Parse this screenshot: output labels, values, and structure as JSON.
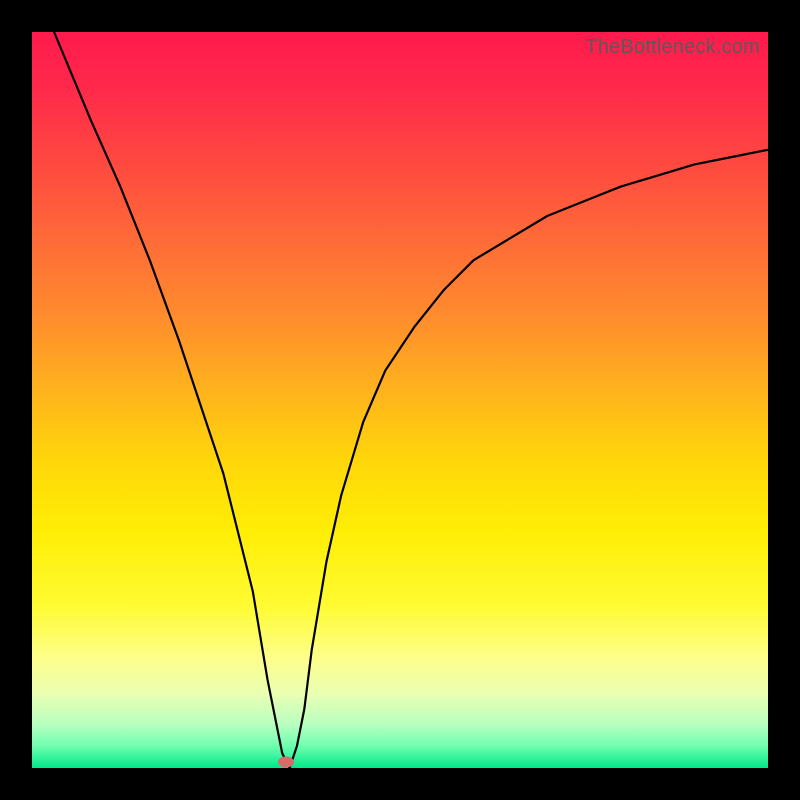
{
  "watermark": "TheBottleneck.com",
  "chart_data": {
    "type": "line",
    "title": "",
    "xlabel": "",
    "ylabel": "",
    "xlim": [
      0,
      100
    ],
    "ylim": [
      0,
      100
    ],
    "x": [
      3,
      8,
      12,
      16,
      20,
      23,
      26,
      28,
      30,
      31,
      32,
      33,
      34,
      35,
      36,
      37,
      38,
      40,
      42,
      45,
      48,
      52,
      56,
      60,
      65,
      70,
      75,
      80,
      85,
      90,
      95,
      100
    ],
    "y": [
      100,
      88,
      79,
      69,
      58,
      49,
      40,
      32,
      24,
      18,
      12,
      7,
      2,
      0,
      3,
      8,
      16,
      28,
      37,
      47,
      54,
      60,
      65,
      69,
      72,
      75,
      77,
      79,
      80.5,
      82,
      83,
      84
    ],
    "marker": {
      "x": 34.5,
      "y": 0.8
    },
    "gradient_stops": [
      {
        "pos": 0,
        "color": "#ff1a4d"
      },
      {
        "pos": 50,
        "color": "#ffd60a"
      },
      {
        "pos": 85,
        "color": "#fdff8a"
      },
      {
        "pos": 100,
        "color": "#00e789"
      }
    ]
  }
}
